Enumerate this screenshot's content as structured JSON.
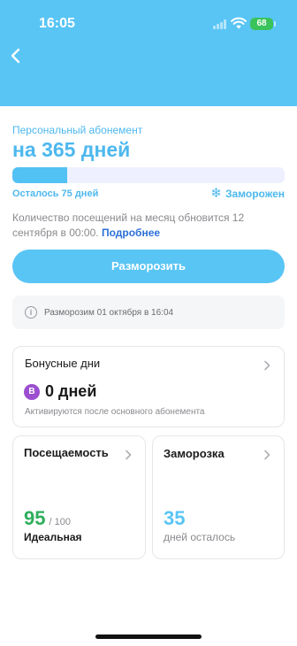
{
  "status_bar": {
    "time": "16:05",
    "battery": "68"
  },
  "header": {
    "background_color": "#59c5f5",
    "back_icon": "chevron-left-icon"
  },
  "subscription": {
    "label": "Персональный абонемент",
    "title": "на 365 дней",
    "progress_fraction": 0.2,
    "remaining": "Осталось 75 дней",
    "status": "Заморожен",
    "status_icon": "snowflake-icon",
    "info_text": "Количество посещений на месяц обновится 12 сентября в 00:00.",
    "info_link": "Подробнее"
  },
  "unfreeze_button": {
    "label": "Разморозить"
  },
  "notice": {
    "icon": "info-icon",
    "text": "Разморозим 01 октября в 16:04"
  },
  "bonus_card": {
    "title": "Бонусные дни",
    "badge": "B",
    "value": "0 дней",
    "subtitle": "Активируются после основного абонемента"
  },
  "attendance_card": {
    "title": "Посещаемость",
    "value": "95",
    "max": "/ 100",
    "status": "Идеальная",
    "accent": "#2fae5c"
  },
  "freeze_card": {
    "title": "Заморозка",
    "value": "35",
    "subtitle": "дней осталось",
    "accent": "#59c5f5"
  }
}
